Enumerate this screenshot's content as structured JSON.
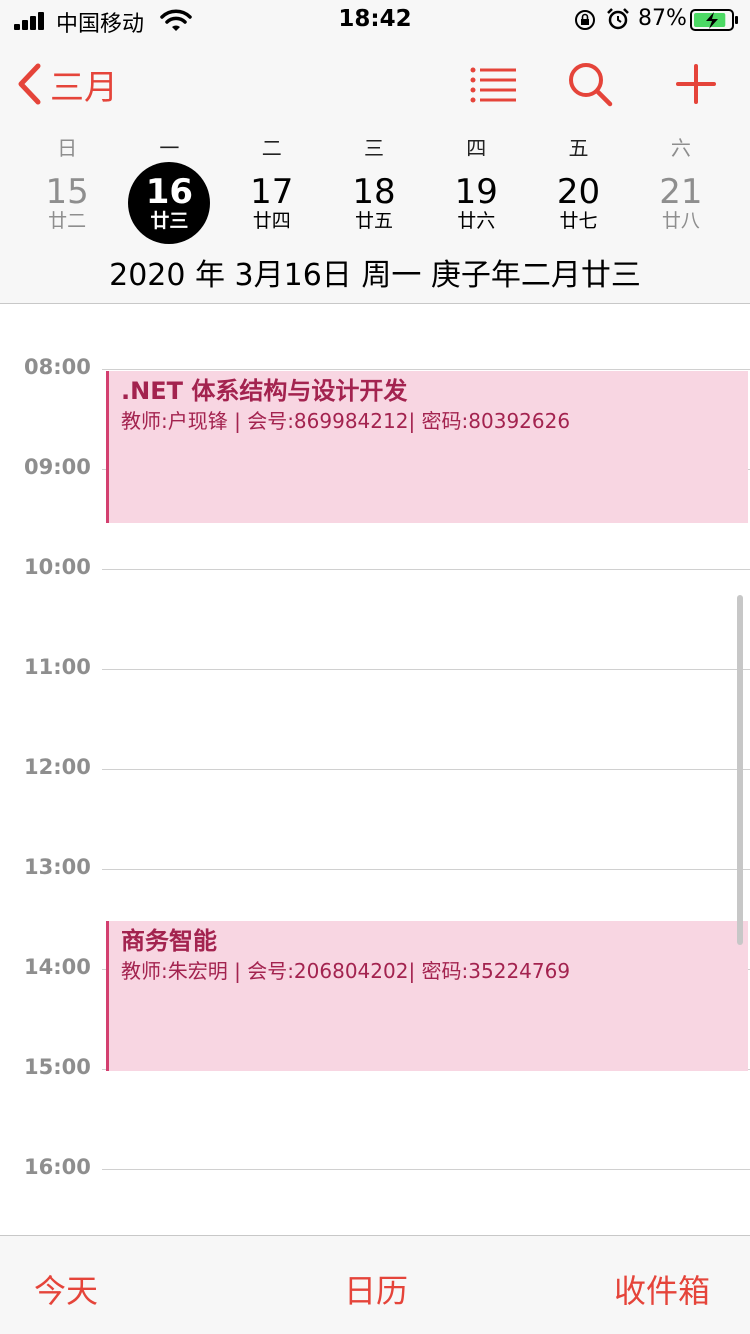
{
  "status_bar": {
    "carrier": "中国移动",
    "time": "18:42",
    "battery_percent": "87%",
    "battery_level": 0.87,
    "icons": [
      "signal-icon",
      "wifi-icon",
      "orientation-lock-icon",
      "alarm-icon",
      "battery-charging-icon"
    ]
  },
  "header": {
    "back_label": "三月",
    "icons": [
      "chevron-left-icon",
      "list-icon",
      "search-icon",
      "plus-icon"
    ],
    "weekdays": [
      "日",
      "一",
      "二",
      "三",
      "四",
      "五",
      "六"
    ],
    "days": [
      {
        "num": "15",
        "lunar": "廿二"
      },
      {
        "num": "16",
        "lunar": "廿三"
      },
      {
        "num": "17",
        "lunar": "廿四"
      },
      {
        "num": "18",
        "lunar": "廿五"
      },
      {
        "num": "19",
        "lunar": "廿六"
      },
      {
        "num": "20",
        "lunar": "廿七"
      },
      {
        "num": "21",
        "lunar": "廿八"
      }
    ],
    "date_line": "2020 年 3月16日 周一   庚子年二月廿三"
  },
  "timeline": {
    "hours": [
      "08:00",
      "09:00",
      "10:00",
      "11:00",
      "12:00",
      "13:00",
      "14:00",
      "15:00",
      "16:00"
    ],
    "events": [
      {
        "title": ".NET 体系结构与设计开发",
        "detail": "教师:户现锋 | 会号:869984212| 密码:80392626"
      },
      {
        "title": "商务智能",
        "detail": "教师:朱宏明 | 会号:206804202| 密码:35224769"
      }
    ]
  },
  "tabbar": {
    "today": "今天",
    "calendars": "日历",
    "inbox": "收件箱"
  },
  "colors": {
    "accent": "#e5443a",
    "event_bg": "#f8d6e2",
    "event_bar": "#d33f6f",
    "event_text": "#a3234f"
  }
}
